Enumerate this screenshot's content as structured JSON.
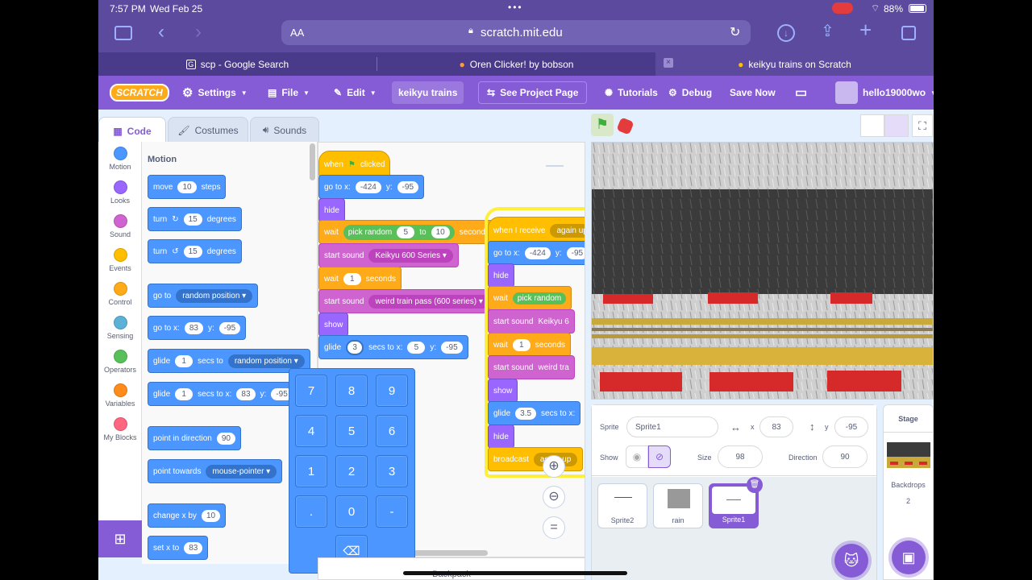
{
  "status": {
    "time": "7:57 PM",
    "date": "Wed Feb 25",
    "battery": "88%"
  },
  "browser": {
    "text_size": "AA",
    "url": "scratch.mit.edu",
    "tabs": [
      {
        "label": "scp - Google Search"
      },
      {
        "label": "Oren Clicker! by bobson"
      },
      {
        "label": "keikyu trains on Scratch"
      }
    ]
  },
  "menu": {
    "logo": "SCRATCH",
    "settings": "Settings",
    "file": "File",
    "edit": "Edit",
    "project_title": "keikyu trains",
    "see_project": "See Project Page",
    "tutorials": "Tutorials",
    "debug": "Debug",
    "save_now": "Save Now",
    "username": "hello19000wo"
  },
  "editor_tabs": {
    "code": "Code",
    "costumes": "Costumes",
    "sounds": "Sounds"
  },
  "categories": [
    {
      "label": "Motion",
      "color": "#4c97ff"
    },
    {
      "label": "Looks",
      "color": "#9966ff"
    },
    {
      "label": "Sound",
      "color": "#cf63cf"
    },
    {
      "label": "Events",
      "color": "#ffbf00"
    },
    {
      "label": "Control",
      "color": "#ffab19"
    },
    {
      "label": "Sensing",
      "color": "#5cb1d6"
    },
    {
      "label": "Operators",
      "color": "#59c059"
    },
    {
      "label": "Variables",
      "color": "#ff8c1a"
    },
    {
      "label": "My Blocks",
      "color": "#ff6680"
    }
  ],
  "palette": {
    "heading": "Motion",
    "move": "move",
    "move_val": "10",
    "steps": "steps",
    "turn": "turn",
    "turn_val": "15",
    "degrees": "degrees",
    "goto": "go to",
    "random_position": "random position",
    "goto_xy": "go to x:",
    "x_val": "83",
    "y": "y:",
    "y_val": "-95",
    "glide": "glide",
    "glide_val": "1",
    "secs_to": "secs to",
    "secs_to_x": "secs to x:",
    "point_dir": "point in direction",
    "dir_val": "90",
    "point_towards": "point towards",
    "mouse_pointer": "mouse-pointer",
    "change_x": "change x by",
    "change_val": "10",
    "set_x": "set x to",
    "set_val": "83"
  },
  "script1": {
    "when": "when",
    "clicked": "clicked",
    "goto_x": "go to x:",
    "x": "-424",
    "y": "y:",
    "yv": "-95",
    "hide": "hide",
    "wait": "wait",
    "pick_random": "pick random",
    "r1": "5",
    "to": "to",
    "r2": "10",
    "seconds": "seconds",
    "start_sound": "start sound",
    "sound1": "Keikyu 600 Series",
    "wait2": "wait",
    "w2": "1",
    "seconds2": "seconds",
    "start_sound2": "start sound",
    "sound2": "weird train pass (600 series)",
    "show": "show",
    "glide": "glide",
    "g": "3",
    "secs_to_x": "secs to x:",
    "gx": "5",
    "gy_lbl": "y:",
    "gy": "-95"
  },
  "script2": {
    "when_receive": "when I receive",
    "msg": "again up",
    "goto_x": "go to x:",
    "x": "-424",
    "y": "y:",
    "yv": "-95",
    "hide": "hide",
    "wait": "wait",
    "pick_random": "pick random",
    "start_sound": "start sound",
    "sound": "Keikyu 6",
    "wait2": "wait",
    "w2": "1",
    "seconds": "seconds",
    "start_sound2": "start sound",
    "sound2": "weird tra",
    "show": "show",
    "glide": "glide",
    "g": "3.5",
    "secs_to_x": "secs to x:",
    "hide2": "hide",
    "broadcast": "broadcast",
    "bmsg": "again up"
  },
  "keypad": [
    "7",
    "8",
    "9",
    "4",
    "5",
    "6",
    "1",
    "2",
    "3",
    ".",
    "0",
    "-"
  ],
  "backpack": "Backpack",
  "sprite_info": {
    "sprite_lbl": "Sprite",
    "sprite_name": "Sprite1",
    "x_lbl": "x",
    "x": "83",
    "y_lbl": "y",
    "y": "-95",
    "show_lbl": "Show",
    "size_lbl": "Size",
    "size": "98",
    "dir_lbl": "Direction",
    "dir": "90"
  },
  "sprites": [
    "Sprite2",
    "rain",
    "Sprite1"
  ],
  "stage_panel": {
    "title": "Stage",
    "backdrops": "Backdrops",
    "count": "2"
  }
}
